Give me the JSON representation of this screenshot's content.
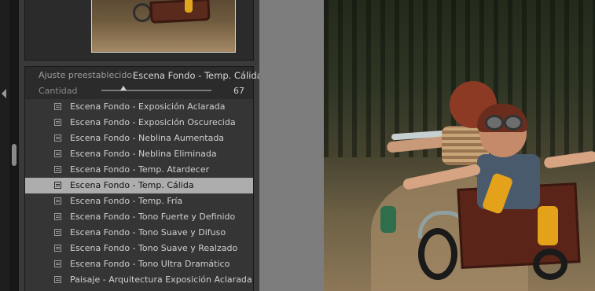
{
  "preset_panel": {
    "preset_label": "Ajuste preestablecido:",
    "preset_value": "Escena Fondo - Temp. Cálida",
    "amount_label": "Cantidad",
    "amount_value": "67",
    "amount_fraction": 0.2
  },
  "preset_list": [
    {
      "label": "Escena Fondo - Exposición Aclarada",
      "selected": false
    },
    {
      "label": "Escena Fondo - Exposición Oscurecida",
      "selected": false
    },
    {
      "label": "Escena Fondo - Neblina Aumentada",
      "selected": false
    },
    {
      "label": "Escena Fondo - Neblina Eliminada",
      "selected": false
    },
    {
      "label": "Escena Fondo - Temp. Atardecer",
      "selected": false
    },
    {
      "label": "Escena Fondo - Temp. Cálida",
      "selected": true
    },
    {
      "label": "Escena Fondo - Temp. Fría",
      "selected": false
    },
    {
      "label": "Escena Fondo - Tono Fuerte y Definido",
      "selected": false
    },
    {
      "label": "Escena Fondo - Tono Suave y Difuso",
      "selected": false
    },
    {
      "label": "Escena Fondo - Tono Suave y Realzado",
      "selected": false
    },
    {
      "label": "Escena Fondo - Tono Ultra Dramático",
      "selected": false
    },
    {
      "label": "Paisaje - Arquitectura Exposición Aclarada",
      "selected": false
    }
  ],
  "colors": {
    "panel_bg": "#3a3a3a",
    "selected_row": "#adadad",
    "gray_gap": "#7d7d7d"
  }
}
